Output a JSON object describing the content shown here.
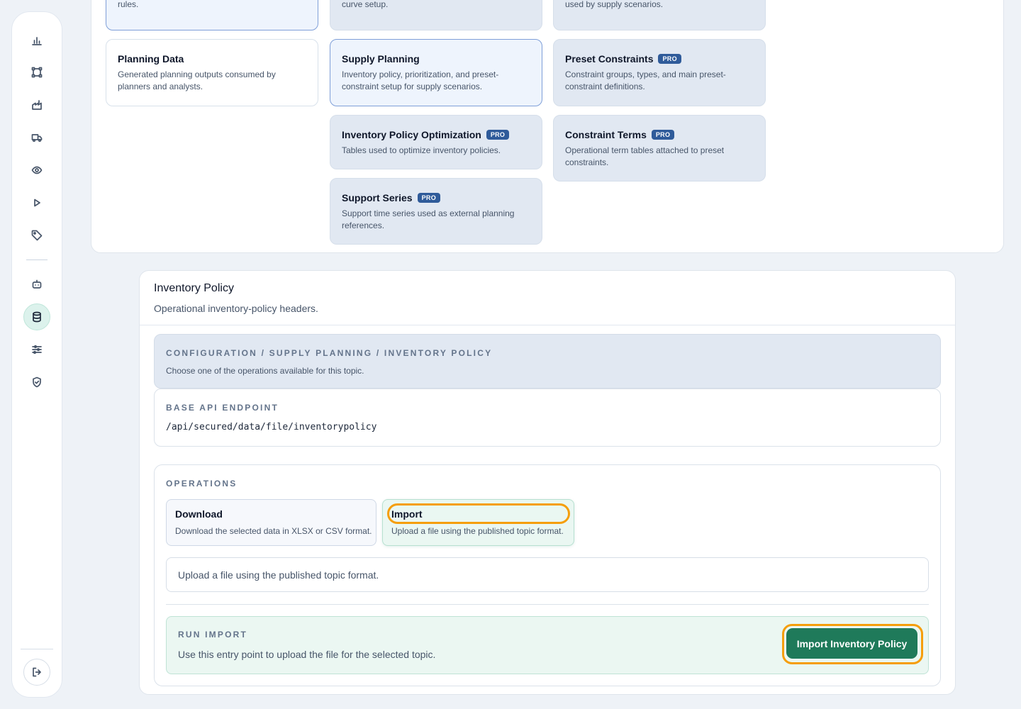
{
  "sidebar": {
    "items": [
      {
        "icon": "bar-chart-icon"
      },
      {
        "icon": "network-nodes-icon"
      },
      {
        "icon": "factory-icon"
      },
      {
        "icon": "truck-icon"
      },
      {
        "icon": "eye-icon"
      },
      {
        "icon": "play-icon"
      },
      {
        "icon": "tag-icon"
      },
      {
        "icon": "bot-icon"
      },
      {
        "icon": "database-icon",
        "active": true
      },
      {
        "icon": "sliders-icon"
      },
      {
        "icon": "shield-check-icon"
      }
    ],
    "logout_icon": "logout-icon"
  },
  "catalog": {
    "top_row": [
      {
        "desc": "Setup tables, views, parameters, and supporting rules."
      },
      {
        "desc": "Workflow, released demand, and temporal split curve setup."
      },
      {
        "desc": "Demand and safety-stock prioritization models used by supply scenarios."
      }
    ],
    "cards": {
      "planning_data": {
        "title": "Planning Data",
        "desc": "Generated planning outputs consumed by planners and analysts."
      },
      "supply_planning": {
        "title": "Supply Planning",
        "desc": "Inventory policy, prioritization, and preset-constraint setup for supply scenarios."
      },
      "preset_constraints": {
        "title": "Preset Constraints",
        "badge": "PRO",
        "desc": "Constraint groups, types, and main preset-constraint definitions."
      },
      "ipo": {
        "title": "Inventory Policy Optimization",
        "badge": "PRO",
        "desc": "Tables used to optimize inventory policies."
      },
      "constraint_terms": {
        "title": "Constraint Terms",
        "badge": "PRO",
        "desc": "Operational term tables attached to preset constraints."
      },
      "support_series": {
        "title": "Support Series",
        "badge": "PRO",
        "desc": "Support time series used as external planning references."
      }
    }
  },
  "panel": {
    "title": "Inventory Policy",
    "subtitle": "Operational inventory-policy headers.",
    "path": "CONFIGURATION / SUPPLY PLANNING / INVENTORY POLICY",
    "path_desc": "Choose one of the operations available for this topic.",
    "endpoint_label": "BASE API ENDPOINT",
    "endpoint_value": "/api/secured/data/file/inventorypolicy",
    "operations_label": "OPERATIONS",
    "operations": {
      "download": {
        "title": "Download",
        "desc": "Download the selected data in XLSX or CSV format."
      },
      "import": {
        "title": "Import",
        "desc": "Upload a file using the published topic format.",
        "selected": true
      }
    },
    "message": "Upload a file using the published topic format.",
    "run_label": "RUN IMPORT",
    "run_desc": "Use this entry point to upload the file for the selected topic.",
    "run_button": "Import Inventory Policy"
  }
}
